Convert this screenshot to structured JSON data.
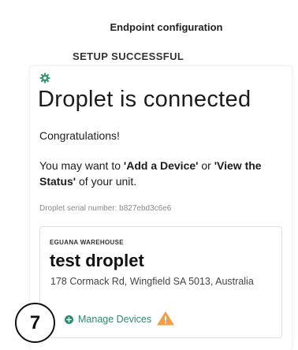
{
  "header": {
    "title": "Endpoint configuration"
  },
  "setup": {
    "status": "SETUP SUCCESSFUL"
  },
  "main": {
    "title": "Droplet is connected",
    "congrats": "Congratulations!",
    "hint": {
      "prefix": "You may want to ",
      "add_device": "'Add a Device'",
      "middle": " or ",
      "view_status": "'View the Status'",
      "suffix": " of your unit."
    },
    "serial": "Droplet serial number: b827ebd3c6e6"
  },
  "device": {
    "site": "EGUANA WAREHOUSE",
    "name": "test droplet",
    "address": "178 Cormack Rd, Wingfield SA 5013, Australia",
    "manage_label": "Manage Devices"
  },
  "step": {
    "number": "7"
  },
  "colors": {
    "accent": "#2e8b6b",
    "warning": "#f0a04b"
  }
}
